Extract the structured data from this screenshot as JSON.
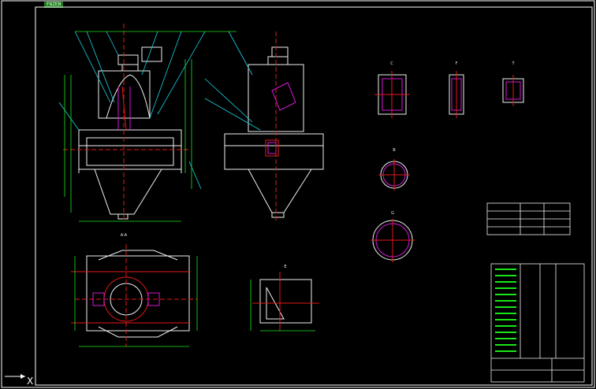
{
  "viewport": {
    "background": "#000000"
  },
  "tag": {
    "label": "F8ZEN",
    "color": "#1f7a1f"
  },
  "ucs": {
    "axis_label": "X"
  },
  "colors": {
    "border": "#ffffff",
    "green": "#19e619",
    "cyan": "#19d4e6",
    "red": "#e61919",
    "magenta": "#d419d4",
    "yellow": "#e6e619",
    "white": "#f0f0f0"
  },
  "views": {
    "section_label": "A-A",
    "detail_labels": [
      "C",
      "F",
      "T"
    ],
    "top_small_label": "E",
    "circle_labels": [
      "B",
      "G"
    ]
  }
}
